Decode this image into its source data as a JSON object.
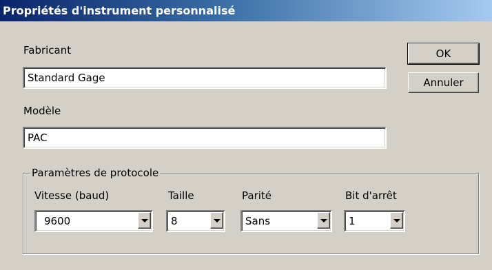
{
  "window": {
    "title": "Propriétés d'instrument personnalisé"
  },
  "fields": {
    "manufacturer": {
      "label": "Fabricant",
      "value": "Standard Gage"
    },
    "model": {
      "label": "Modèle",
      "value": "PAC"
    }
  },
  "buttons": {
    "ok": "OK",
    "cancel": "Annuler"
  },
  "protocol": {
    "group_label": "Paramètres de protocole",
    "baud": {
      "label": "Vitesse (baud)",
      "value": "9600"
    },
    "size": {
      "label": "Taille",
      "value": "8"
    },
    "parity": {
      "label": "Parité",
      "value": "Sans"
    },
    "stop_bit": {
      "label": "Bit d'arrêt",
      "value": "1"
    }
  }
}
